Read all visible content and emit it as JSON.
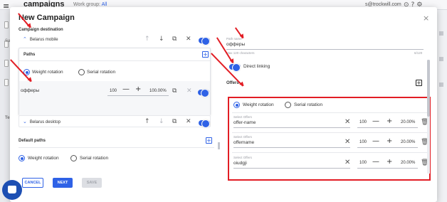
{
  "background": {
    "app_title": "campaigns",
    "workgroup_label": "Work group:",
    "workgroup_value": "All",
    "user_email": "s@trockwill.com",
    "side_label_1": "Sa",
    "side_label_2": "Te"
  },
  "modal": {
    "title": "New Campaign",
    "close_symbol": "×",
    "campaign_destination_label": "Campaign destination",
    "belarus_mobile": {
      "name": "Belarus mobile",
      "paths_label": "Paths",
      "rotation_options": [
        "Weight rotation",
        "Serial rotation"
      ],
      "selected_rotation": "Weight rotation",
      "path_name": "офферы",
      "path_weight": "100",
      "path_percent": "100.00%"
    },
    "belarus_desktop": {
      "name": "Belarus desktop"
    },
    "default_paths": {
      "label": "Default paths",
      "rotation_options": [
        "Weight rotation",
        "Serial rotation"
      ],
      "selected_rotation": "Weight rotation"
    },
    "path_editor": {
      "path_name_label": "Path name",
      "path_name_value": "офферы",
      "max_chars_note": "Max 120 characters",
      "char_count": "6/120",
      "direct_linking_label": "Direct linking",
      "offers_label": "Offers",
      "rotation_options": [
        "Weight rotation",
        "Serial rotation"
      ],
      "selected_rotation": "Weight rotation",
      "select_offers_label": "Select Offers",
      "offers": [
        {
          "name": "offer-name",
          "weight": "100",
          "percent": "20.00%"
        },
        {
          "name": "offername",
          "weight": "100",
          "percent": "20.00%"
        },
        {
          "name": "oiudgji",
          "weight": "100",
          "percent": "20.00%"
        }
      ]
    },
    "buttons": {
      "cancel": "CANCEL",
      "next": "NEXT",
      "save": "SAVE"
    }
  },
  "icons": {
    "up": "↑",
    "down": "↓",
    "copy": "⧉",
    "close": "✕",
    "chevron_up": "⌃",
    "chevron_down": "⌄",
    "minus": "—",
    "plus": "+",
    "trash": "🗑",
    "burger": "≡",
    "plus_box": "+"
  },
  "colors": {
    "accent": "#2f62e6",
    "highlight": "#e21d24"
  }
}
